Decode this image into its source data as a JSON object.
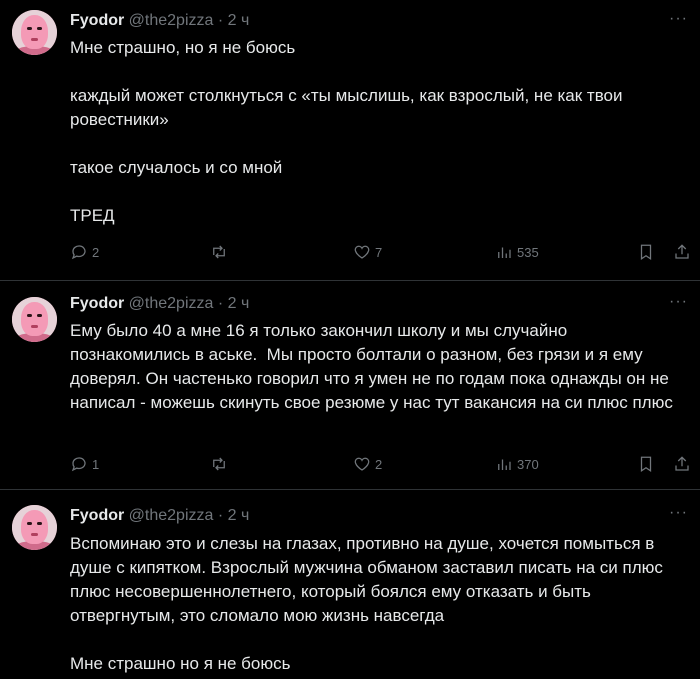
{
  "tweets": [
    {
      "name": "Fyodor",
      "handle": "@the2pizza",
      "separator": "·",
      "time": "2 ч",
      "more": "···",
      "text": "Мне страшно, но я не боюсь\n\nкаждый может столкнуться с «ты мыслишь, как взрослый, не как твои ровестники»\n\nтакое случалось и со мной\n\nТРЕД",
      "replies": "2",
      "retweets": "",
      "likes": "7",
      "views": "535"
    },
    {
      "name": "Fyodor",
      "handle": "@the2pizza",
      "separator": "·",
      "time": "2 ч",
      "more": "···",
      "text": "Ему было 40 а мне 16 я только закончил школу и мы случайно познакомились в аське.  Мы просто болтали о разном, без грязи и я ему доверял. Он частенько говорил что я умен не по годам пока однажды он не написал - можешь скинуть свое резюме у нас тут вакансия на си плюс плюс",
      "replies": "1",
      "retweets": "",
      "likes": "2",
      "views": "370"
    },
    {
      "name": "Fyodor",
      "handle": "@the2pizza",
      "separator": "·",
      "time": "2 ч",
      "more": "···",
      "text": "Вспоминаю это и слезы на глазах, противно на душе, хочется помыться в душе с кипятком. Взрослый мужчина обманом заставил писать на си плюс плюс несовершеннолетнего, который боялся ему отказать и быть отвергнутым, это сломало мою жизнь навсегда\n\nМне страшно но я не боюсь"
    }
  ],
  "icons": {
    "reply": "reply-icon",
    "retweet": "retweet-icon",
    "like": "heart-icon",
    "views": "views-icon",
    "bookmark": "bookmark-icon",
    "share": "share-icon"
  },
  "colors": {
    "background": "#000000",
    "text": "#e7e9ea",
    "muted": "#71767b",
    "divider": "#2f3336"
  }
}
